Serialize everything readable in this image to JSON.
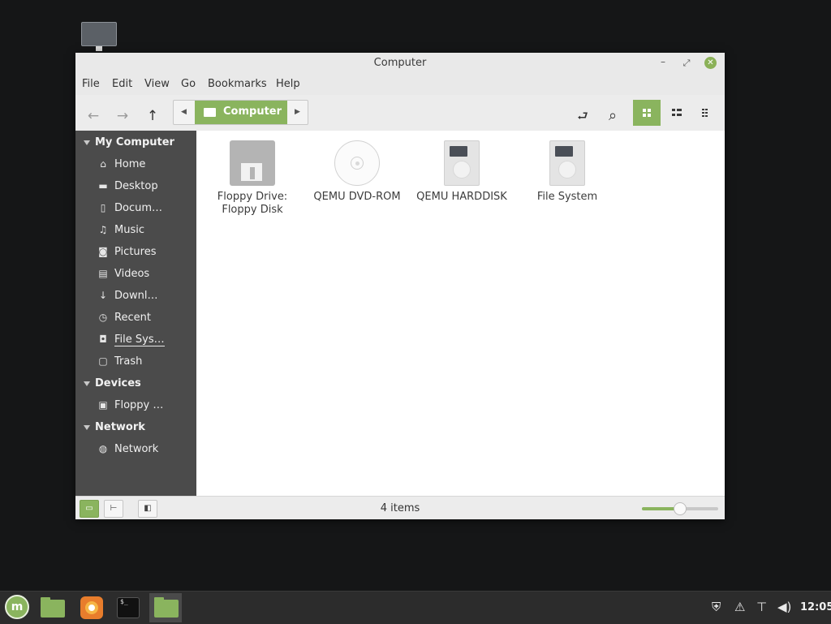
{
  "window": {
    "title": "Computer",
    "minimize": "–",
    "maximize": "⤢",
    "close": "✕"
  },
  "menubar": [
    "File",
    "Edit",
    "View",
    "Go",
    "Bookmarks",
    "Help"
  ],
  "toolbar": {
    "back": "←",
    "forward": "→",
    "up": "↑",
    "location": "Computer",
    "toggle_location": "⮐",
    "search": "⌕"
  },
  "sidebar": {
    "sections": [
      {
        "title": "My Computer",
        "items": [
          {
            "label": "Home",
            "icon": "home-icon",
            "glyph": "⌂"
          },
          {
            "label": "Desktop",
            "icon": "desktop-icon",
            "glyph": "▬"
          },
          {
            "label": "Docum…",
            "icon": "document-icon",
            "glyph": "▯"
          },
          {
            "label": "Music",
            "icon": "music-icon",
            "glyph": "♫"
          },
          {
            "label": "Pictures",
            "icon": "camera-icon",
            "glyph": "◙"
          },
          {
            "label": "Videos",
            "icon": "film-icon",
            "glyph": "▤"
          },
          {
            "label": "Downl…",
            "icon": "download-icon",
            "glyph": "↓"
          },
          {
            "label": "Recent",
            "icon": "clock-icon",
            "glyph": "◷"
          },
          {
            "label": "File Sys…",
            "icon": "drive-icon",
            "glyph": "◘"
          },
          {
            "label": "Trash",
            "icon": "trash-icon",
            "glyph": "▢"
          }
        ]
      },
      {
        "title": "Devices",
        "items": [
          {
            "label": "Floppy …",
            "icon": "floppy-icon",
            "glyph": "▣"
          }
        ]
      },
      {
        "title": "Network",
        "items": [
          {
            "label": "Network",
            "icon": "globe-icon",
            "glyph": "◍"
          }
        ]
      }
    ]
  },
  "files": [
    {
      "name": "Floppy Drive:",
      "name2": "Floppy Disk",
      "type": "floppy"
    },
    {
      "name": "QEMU DVD-ROM",
      "name2": "",
      "type": "dvd"
    },
    {
      "name": "QEMU HARDDISK",
      "name2": "",
      "type": "hdd"
    },
    {
      "name": "File System",
      "name2": "",
      "type": "hdd"
    }
  ],
  "statusbar": {
    "item_count": "4 items",
    "zoom_level": 0.5
  },
  "taskbar": {
    "menu_label": "m",
    "terminal_prompt": "$_",
    "clock": "12:05"
  },
  "colors": {
    "accent": "#8ab45e",
    "sidebar_bg": "#4b4b4b",
    "taskbar_bg": "#2c2c2c"
  }
}
